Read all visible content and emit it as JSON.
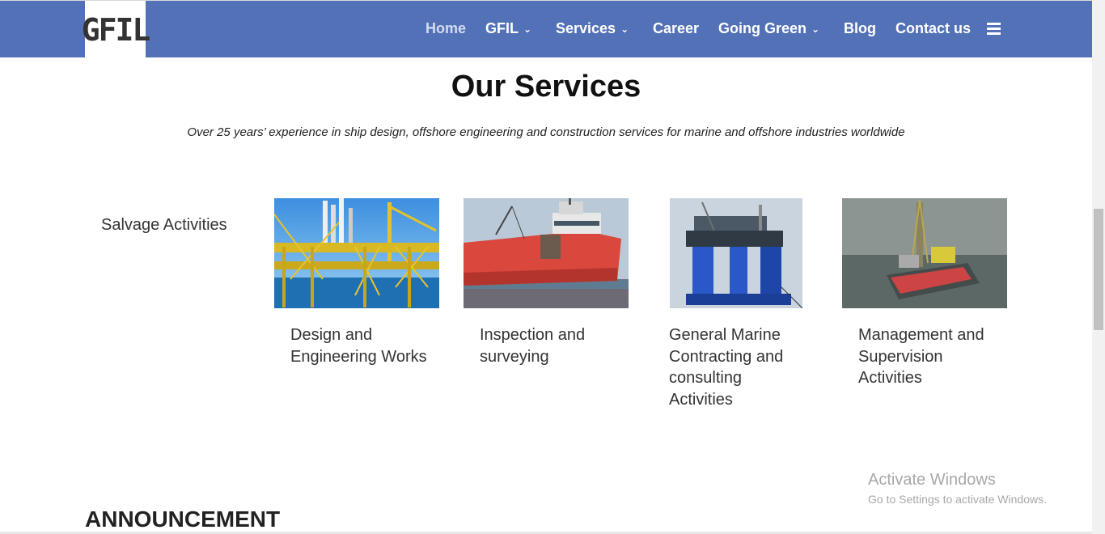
{
  "header": {
    "logo_text": "GFIL",
    "nav": [
      {
        "label": "Home",
        "dropdown": false
      },
      {
        "label": "GFIL",
        "dropdown": true
      },
      {
        "label": "Services",
        "dropdown": true
      },
      {
        "label": "Career",
        "dropdown": false
      },
      {
        "label": "Going Green",
        "dropdown": true
      },
      {
        "label": "Blog",
        "dropdown": false
      },
      {
        "label": "Contact us",
        "dropdown": false
      }
    ],
    "menu_icon": "hamburger-icon",
    "colors": {
      "navbar": "#5371b6",
      "active": "#d4dcf0"
    }
  },
  "services": {
    "title": "Our Services",
    "subtitle": "Over 25 years’ experience in ship design, offshore engineering and construction services for marine and offshore industries worldwide",
    "salvage_label": "Salvage Activities",
    "cards": [
      {
        "title": "Design and Engineering Works",
        "image": "offshore-platform-photo"
      },
      {
        "title": "Inspection and surveying",
        "image": "red-vessel-photo"
      },
      {
        "title": "General Marine Contracting and consulting Activities",
        "image": "semi-submersible-diagram"
      },
      {
        "title": "Management and Supervision Activities",
        "image": "drilling-rig-photo"
      }
    ]
  },
  "announcement": {
    "title": "ANNOUNCEMENT"
  },
  "watermark": {
    "line1": "Activate Windows",
    "line2": "Go to Settings to activate Windows."
  }
}
